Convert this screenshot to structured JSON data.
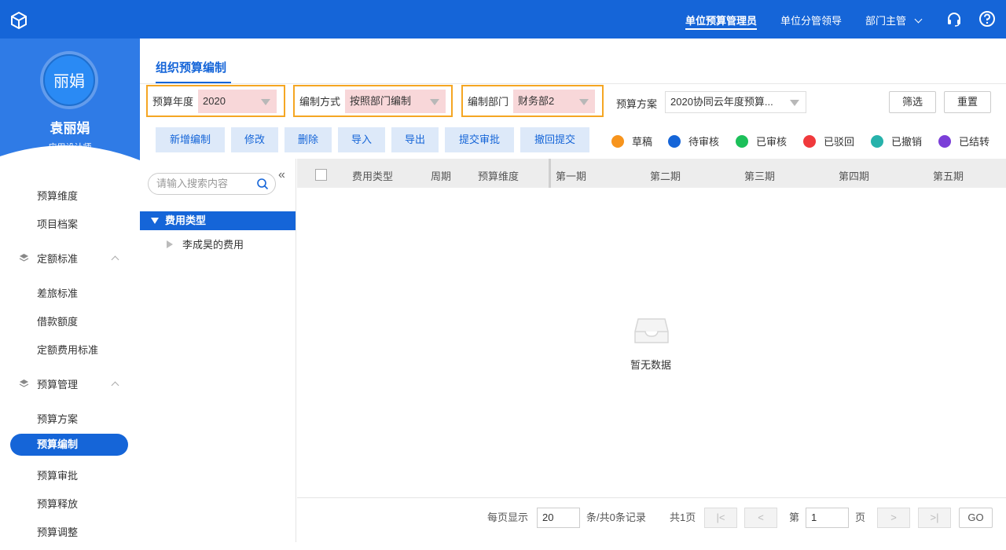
{
  "topbar": {
    "logo_icon": "cube-icon",
    "roles": [
      "单位预算管理员",
      "单位分管领导",
      "部门主管"
    ],
    "icons": [
      "headset-icon",
      "help-icon",
      "chevron-down-icon"
    ]
  },
  "profile": {
    "avatar_text": "丽娟",
    "name": "袁丽娟",
    "title": "应用设计师"
  },
  "menu": {
    "item_budget_dimension": "预算维度",
    "item_project_archive": "项目档案",
    "group_quota": "定额标准",
    "item_travel": "差旅标准",
    "item_loan": "借款额度",
    "item_quota_fee": "定额费用标准",
    "group_budget": "预算管理",
    "item_plan": "预算方案",
    "item_compile": "预算编制",
    "item_approve": "预算审批",
    "item_release": "预算释放",
    "item_adjust": "预算调整"
  },
  "main": {
    "tab": "组织预算编制"
  },
  "filters": {
    "year_label": "预算年度",
    "year_value": "2020",
    "method_label": "编制方式",
    "method_value": "按照部门编制",
    "dept_label": "编制部门",
    "dept_value": "财务部2",
    "plan_label": "预算方案",
    "plan_value": "2020协同云年度预算...",
    "filter_btn": "筛选",
    "reset_btn": "重置"
  },
  "toolbar": {
    "add": "新增编制",
    "edit": "修改",
    "delete": "删除",
    "import": "导入",
    "export": "导出",
    "submit": "提交审批",
    "withdraw": "撤回提交"
  },
  "legend": [
    {
      "label": "草稿",
      "color": "#f7941d"
    },
    {
      "label": "待审核",
      "color": "#1565d8"
    },
    {
      "label": "已审核",
      "color": "#1cc05a"
    },
    {
      "label": "已驳回",
      "color": "#f0393c"
    },
    {
      "label": "已撤销",
      "color": "#27b2ab"
    },
    {
      "label": "已结转",
      "color": "#7b3fd8"
    }
  ],
  "tree": {
    "search_placeholder": "请输入搜索内容",
    "root": "费用类型",
    "child": "李成昊的费用"
  },
  "table": {
    "headers": [
      "费用类型",
      "周期",
      "预算维度",
      "第一期",
      "第二期",
      "第三期",
      "第四期",
      "第五期"
    ],
    "empty_text": "暂无数据"
  },
  "pager": {
    "per_page_label": "每页显示",
    "per_page_value": "20",
    "summary": "条/共0条记录",
    "total_pages": "共1页",
    "page_prefix": "第",
    "page_value": "1",
    "page_suffix": "页",
    "go": "GO"
  }
}
